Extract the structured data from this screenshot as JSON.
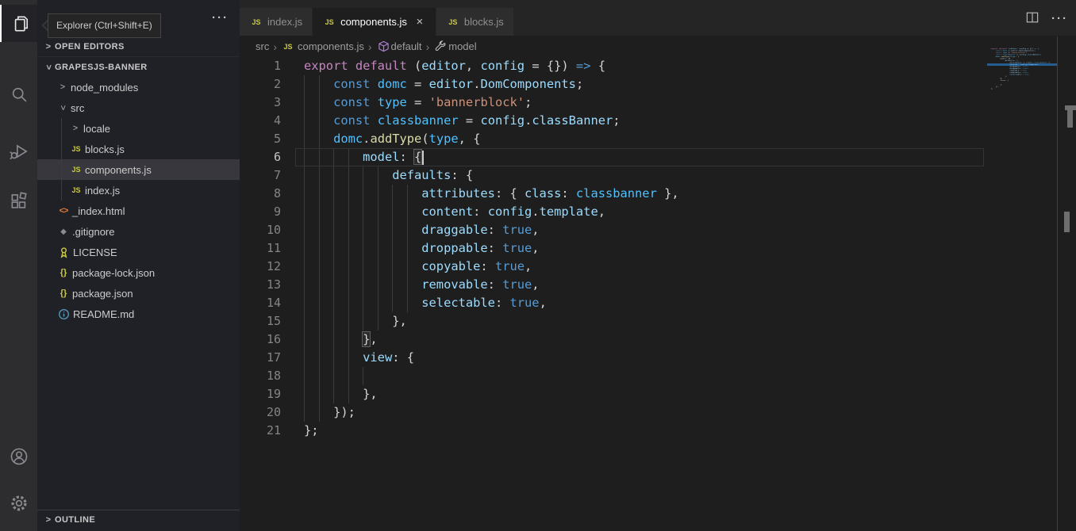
{
  "tooltip": {
    "text": "Explorer (Ctrl+Shift+E)"
  },
  "activity_bar": {
    "top_items": [
      {
        "name": "explorer",
        "active": true
      },
      {
        "name": "search",
        "active": false
      },
      {
        "name": "run-debug",
        "active": false
      },
      {
        "name": "extensions",
        "active": false
      }
    ],
    "bottom_items": [
      {
        "name": "account",
        "active": false
      },
      {
        "name": "settings",
        "active": false
      }
    ]
  },
  "sidebar": {
    "sections": {
      "open_editors": "OPEN EDITORS",
      "outline": "OUTLINE"
    },
    "project": "GRAPESJS-BANNER",
    "tree": [
      {
        "label": "node_modules",
        "lvl": 1,
        "chevron": "collapsed"
      },
      {
        "label": "src",
        "lvl": 1,
        "chevron": "expanded"
      },
      {
        "label": "locale",
        "lvl": 2,
        "chevron": "collapsed"
      },
      {
        "label": "blocks.js",
        "lvl": 2,
        "icon": "js"
      },
      {
        "label": "components.js",
        "lvl": 2,
        "icon": "js",
        "selected": true
      },
      {
        "label": "index.js",
        "lvl": 2,
        "icon": "js"
      },
      {
        "label": "_index.html",
        "lvl": 1,
        "icon": "html"
      },
      {
        "label": ".gitignore",
        "lvl": 1,
        "icon": "git"
      },
      {
        "label": "LICENSE",
        "lvl": 1,
        "icon": "license"
      },
      {
        "label": "package-lock.json",
        "lvl": 1,
        "icon": "json"
      },
      {
        "label": "package.json",
        "lvl": 1,
        "icon": "json"
      },
      {
        "label": "README.md",
        "lvl": 1,
        "icon": "info"
      }
    ]
  },
  "tabs": [
    {
      "label": "index.js",
      "icon": "js",
      "active": false,
      "close": false
    },
    {
      "label": "components.js",
      "icon": "js",
      "active": true,
      "close": true
    },
    {
      "label": "blocks.js",
      "icon": "js",
      "active": false,
      "close": false
    }
  ],
  "breadcrumb": [
    {
      "label": "src"
    },
    {
      "label": "components.js",
      "icon": "js"
    },
    {
      "label": "default",
      "icon": "cube"
    },
    {
      "label": "model",
      "icon": "wrench"
    }
  ],
  "editor": {
    "current_line": 6,
    "lines": [
      {
        "n": 1,
        "g": 0,
        "t": [
          [
            "ctl",
            "export default"
          ],
          [
            "pun",
            " ("
          ],
          [
            "var",
            "editor"
          ],
          [
            "pun",
            ", "
          ],
          [
            "var",
            "config"
          ],
          [
            "pun",
            " = {}) "
          ],
          [
            "kw",
            "=>"
          ],
          [
            "pun",
            " {"
          ]
        ]
      },
      {
        "n": 2,
        "g": 2,
        "t": [
          [
            "ws",
            "    "
          ],
          [
            "kw",
            "const"
          ],
          [
            "pun",
            " "
          ],
          [
            "cvar",
            "domc"
          ],
          [
            "pun",
            " = "
          ],
          [
            "var",
            "editor"
          ],
          [
            "pun",
            "."
          ],
          [
            "var",
            "DomComponents"
          ],
          [
            "pun",
            ";"
          ]
        ]
      },
      {
        "n": 3,
        "g": 2,
        "t": [
          [
            "ws",
            "    "
          ],
          [
            "kw",
            "const"
          ],
          [
            "pun",
            " "
          ],
          [
            "cvar",
            "type"
          ],
          [
            "pun",
            " = "
          ],
          [
            "str",
            "'bannerblock'"
          ],
          [
            "pun",
            ";"
          ]
        ]
      },
      {
        "n": 4,
        "g": 2,
        "t": [
          [
            "ws",
            "    "
          ],
          [
            "kw",
            "const"
          ],
          [
            "pun",
            " "
          ],
          [
            "cvar",
            "classbanner"
          ],
          [
            "pun",
            " = "
          ],
          [
            "var",
            "config"
          ],
          [
            "pun",
            "."
          ],
          [
            "var",
            "classBanner"
          ],
          [
            "pun",
            ";"
          ]
        ]
      },
      {
        "n": 5,
        "g": 2,
        "t": [
          [
            "ws",
            "    "
          ],
          [
            "cvar",
            "domc"
          ],
          [
            "pun",
            "."
          ],
          [
            "fn",
            "addType"
          ],
          [
            "pun",
            "("
          ],
          [
            "cvar",
            "type"
          ],
          [
            "pun",
            ", {"
          ]
        ]
      },
      {
        "n": 6,
        "g": 4,
        "t": [
          [
            "ws",
            "        "
          ],
          [
            "var",
            "model"
          ],
          [
            "pun",
            ": "
          ],
          [
            "bm",
            "{"
          ],
          [
            "caret",
            ""
          ]
        ]
      },
      {
        "n": 7,
        "g": 6,
        "t": [
          [
            "ws",
            "            "
          ],
          [
            "var",
            "defaults"
          ],
          [
            "pun",
            ": {"
          ]
        ]
      },
      {
        "n": 8,
        "g": 8,
        "t": [
          [
            "ws",
            "                "
          ],
          [
            "var",
            "attributes"
          ],
          [
            "pun",
            ": { "
          ],
          [
            "var",
            "class"
          ],
          [
            "pun",
            ": "
          ],
          [
            "cvar",
            "classbanner"
          ],
          [
            "pun",
            " },"
          ]
        ]
      },
      {
        "n": 9,
        "g": 8,
        "t": [
          [
            "ws",
            "                "
          ],
          [
            "var",
            "content"
          ],
          [
            "pun",
            ": "
          ],
          [
            "var",
            "config"
          ],
          [
            "pun",
            "."
          ],
          [
            "var",
            "template"
          ],
          [
            "pun",
            ","
          ]
        ]
      },
      {
        "n": 10,
        "g": 8,
        "t": [
          [
            "ws",
            "                "
          ],
          [
            "var",
            "draggable"
          ],
          [
            "pun",
            ": "
          ],
          [
            "kw",
            "true"
          ],
          [
            "pun",
            ","
          ]
        ]
      },
      {
        "n": 11,
        "g": 8,
        "t": [
          [
            "ws",
            "                "
          ],
          [
            "var",
            "droppable"
          ],
          [
            "pun",
            ": "
          ],
          [
            "kw",
            "true"
          ],
          [
            "pun",
            ","
          ]
        ]
      },
      {
        "n": 12,
        "g": 8,
        "t": [
          [
            "ws",
            "                "
          ],
          [
            "var",
            "copyable"
          ],
          [
            "pun",
            ": "
          ],
          [
            "kw",
            "true"
          ],
          [
            "pun",
            ","
          ]
        ]
      },
      {
        "n": 13,
        "g": 8,
        "t": [
          [
            "ws",
            "                "
          ],
          [
            "var",
            "removable"
          ],
          [
            "pun",
            ": "
          ],
          [
            "kw",
            "true"
          ],
          [
            "pun",
            ","
          ]
        ]
      },
      {
        "n": 14,
        "g": 8,
        "t": [
          [
            "ws",
            "                "
          ],
          [
            "var",
            "selectable"
          ],
          [
            "pun",
            ": "
          ],
          [
            "kw",
            "true"
          ],
          [
            "pun",
            ","
          ]
        ]
      },
      {
        "n": 15,
        "g": 6,
        "t": [
          [
            "ws",
            "            "
          ],
          [
            "pun",
            "},"
          ]
        ]
      },
      {
        "n": 16,
        "g": 4,
        "t": [
          [
            "ws",
            "        "
          ],
          [
            "bm",
            "}"
          ],
          [
            "pun",
            ","
          ]
        ]
      },
      {
        "n": 17,
        "g": 4,
        "t": [
          [
            "ws",
            "        "
          ],
          [
            "var",
            "view"
          ],
          [
            "pun",
            ": {"
          ]
        ]
      },
      {
        "n": 18,
        "g": 5,
        "t": []
      },
      {
        "n": 19,
        "g": 4,
        "t": [
          [
            "ws",
            "        "
          ],
          [
            "pun",
            "},"
          ]
        ]
      },
      {
        "n": 20,
        "g": 2,
        "t": [
          [
            "ws",
            "    "
          ],
          [
            "pun",
            "});"
          ]
        ]
      },
      {
        "n": 21,
        "g": 0,
        "t": [
          [
            "pun",
            "};"
          ]
        ]
      }
    ]
  },
  "colors": {
    "editor_bg": "#1e1e1e",
    "sidebar_bg": "#202127",
    "activity_bar_bg": "#2d2d30",
    "selection_bg": "#37373d",
    "keyword_blue": "#569cd6",
    "control_pink": "#c586c0",
    "property_blue": "#9cdcfe",
    "const_blue": "#4fc1ff",
    "string_orange": "#ce9178",
    "function_yellow": "#dcdcaa",
    "punctuation": "#d4d4d4",
    "js_icon_yellow": "#cbcb41",
    "html_icon_orange": "#e37933",
    "info_icon_blue": "#519aba",
    "symbol_cube_purple": "#b180d7",
    "minimap_cursor_line": "#265d91"
  }
}
